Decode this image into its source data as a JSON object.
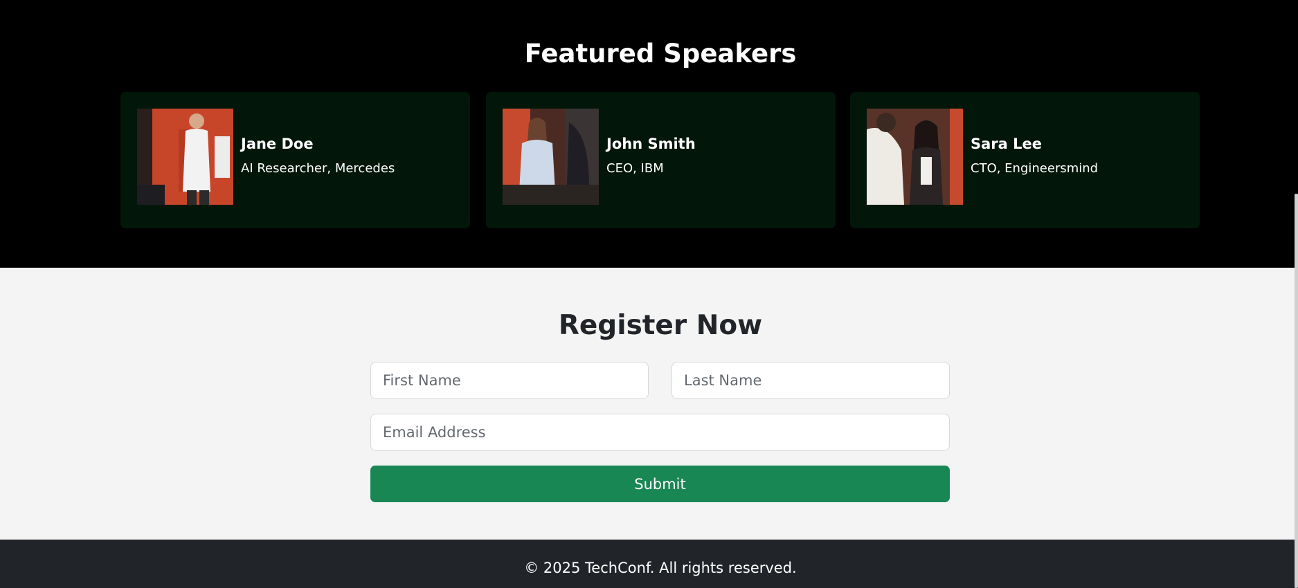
{
  "speakers_section": {
    "title": "Featured Speakers",
    "speakers": [
      {
        "name": "Jane Doe",
        "role": "AI Researcher, Mercedes"
      },
      {
        "name": "John Smith",
        "role": "CEO, IBM"
      },
      {
        "name": "Sara Lee",
        "role": "CTO, Engineersmind"
      }
    ]
  },
  "register_section": {
    "title": "Register Now",
    "first_name_placeholder": "First Name",
    "last_name_placeholder": "Last Name",
    "email_placeholder": "Email Address",
    "submit_label": "Submit"
  },
  "footer": {
    "text": "© 2025 TechConf. All rights reserved."
  },
  "colors": {
    "speakers_bg": "#000000",
    "card_bg": "#03160a",
    "register_bg": "#f4f4f4",
    "submit_bg": "#198754",
    "footer_bg": "#212529"
  }
}
